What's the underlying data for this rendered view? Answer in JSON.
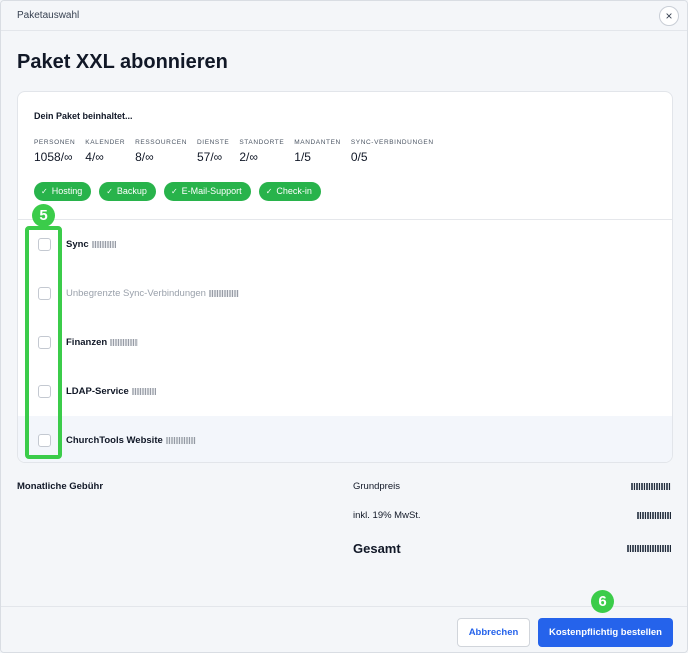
{
  "header": {
    "title": "Paketauswahl",
    "close_icon": "×"
  },
  "page_title": "Paket XXL abonnieren",
  "package": {
    "intro": "Dein Paket beinhaltet...",
    "stats": [
      {
        "label": "PERSONEN",
        "value": "1058/∞"
      },
      {
        "label": "KALENDER",
        "value": "4/∞"
      },
      {
        "label": "RESSOURCEN",
        "value": "8/∞"
      },
      {
        "label": "DIENSTE",
        "value": "57/∞"
      },
      {
        "label": "STANDORTE",
        "value": "2/∞"
      },
      {
        "label": "MANDANTEN",
        "value": "1/5"
      },
      {
        "label": "SYNC-VERBINDUNGEN",
        "value": "0/5"
      }
    ],
    "features": [
      "Hosting",
      "Backup",
      "E-Mail-Support",
      "Check-in"
    ],
    "feature_check_icon": "✓"
  },
  "options": [
    {
      "label": "Sync",
      "disabled": false,
      "checked": false
    },
    {
      "label": "Unbegrenzte Sync-Verbindungen",
      "disabled": true,
      "checked": false
    },
    {
      "label": "Finanzen",
      "disabled": false,
      "checked": false
    },
    {
      "label": "LDAP-Service",
      "disabled": false,
      "checked": false
    },
    {
      "label": "ChurchTools Website",
      "disabled": false,
      "checked": false
    }
  ],
  "fees": {
    "label": "Monatliche Gebühr",
    "base_label": "Grundpreis",
    "vat_label": "inkl. 19% MwSt.",
    "total_label": "Gesamt"
  },
  "steps": {
    "options_marker": "5",
    "order_marker": "6"
  },
  "footer": {
    "cancel_label": "Abbrechen",
    "order_label": "Kostenpflichtig bestellen"
  },
  "colors": {
    "accent": "#2563eb",
    "success": "#28b34b",
    "annotation": "#3bcc4a"
  }
}
